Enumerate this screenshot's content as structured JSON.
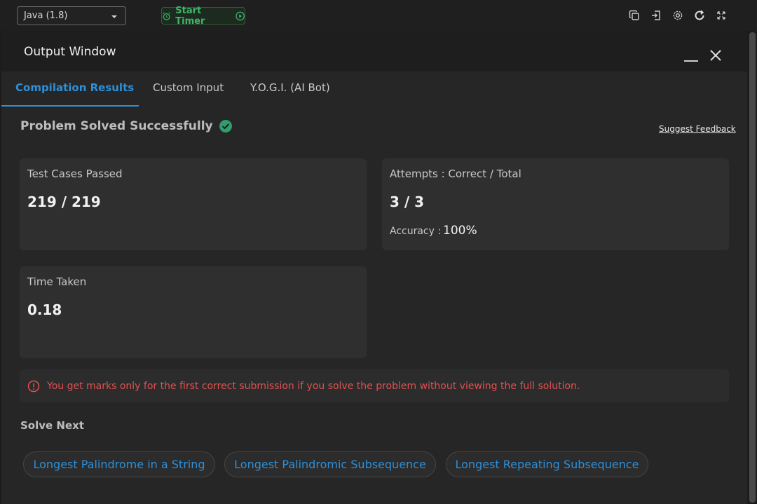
{
  "toolbar": {
    "language_selected": "Java (1.8)",
    "timer_label": "Start Timer",
    "icons": [
      "copy-icon",
      "login-icon",
      "settings-icon",
      "refresh-icon",
      "fullscreen-icon"
    ]
  },
  "output_window": {
    "title": "Output Window"
  },
  "tabs": [
    {
      "label": "Compilation Results",
      "active": true
    },
    {
      "label": "Custom Input",
      "active": false
    },
    {
      "label": "Y.O.G.I. (AI Bot)",
      "active": false
    }
  ],
  "status": {
    "message": "Problem Solved Successfully",
    "feedback_link": "Suggest Feedback"
  },
  "stats": {
    "test_cases_label": "Test Cases Passed",
    "test_cases_value": "219 / 219",
    "attempts_label": "Attempts : Correct / Total",
    "attempts_value": "3 / 3",
    "accuracy_label": "Accuracy :",
    "accuracy_value": "100%",
    "time_label": "Time Taken",
    "time_value": "0.18"
  },
  "warning": {
    "text": "You get marks only for the first correct submission if you solve the problem without viewing the full solution."
  },
  "solve_next": {
    "title": "Solve Next",
    "items": [
      "Longest Palindrome in a String",
      "Longest Palindromic Subsequence",
      "Longest Repeating Subsequence"
    ]
  },
  "colors": {
    "accent_blue": "#2d8fd8",
    "success_green": "#3fb56a",
    "warning_red": "#e0504f"
  }
}
